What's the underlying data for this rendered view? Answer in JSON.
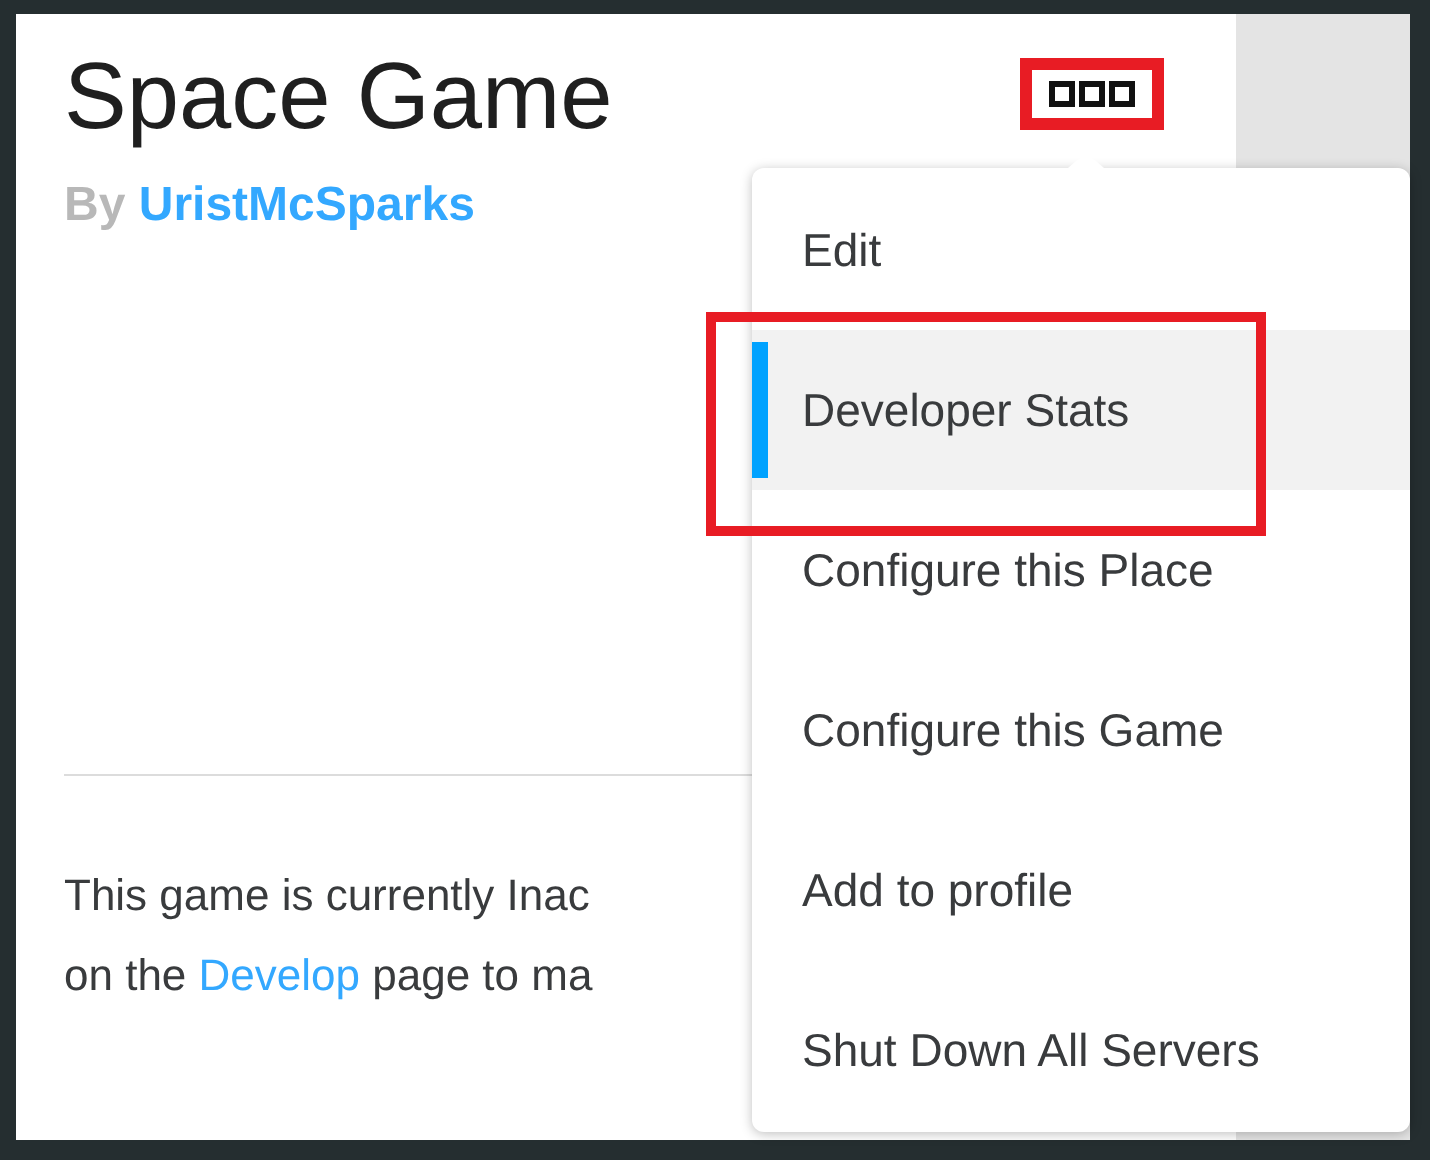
{
  "game": {
    "title": "Space Game",
    "by_label": "By",
    "creator": "UristMcSparks"
  },
  "notice": {
    "line_1": "This game is currently Inac",
    "line_2_before": "on the ",
    "line_2_link": "Develop",
    "line_2_after": " page to ma"
  },
  "more_button": {
    "highlighted": true
  },
  "menu": {
    "items": [
      {
        "label": "Edit",
        "selected": false,
        "highlighted": false
      },
      {
        "label": "Developer Stats",
        "selected": true,
        "highlighted": true
      },
      {
        "label": "Configure this Place",
        "selected": false,
        "highlighted": false
      },
      {
        "label": "Configure this Game",
        "selected": false,
        "highlighted": false
      },
      {
        "label": "Add to profile",
        "selected": false,
        "highlighted": false
      },
      {
        "label": "Shut Down All Servers",
        "selected": false,
        "highlighted": false
      }
    ]
  }
}
